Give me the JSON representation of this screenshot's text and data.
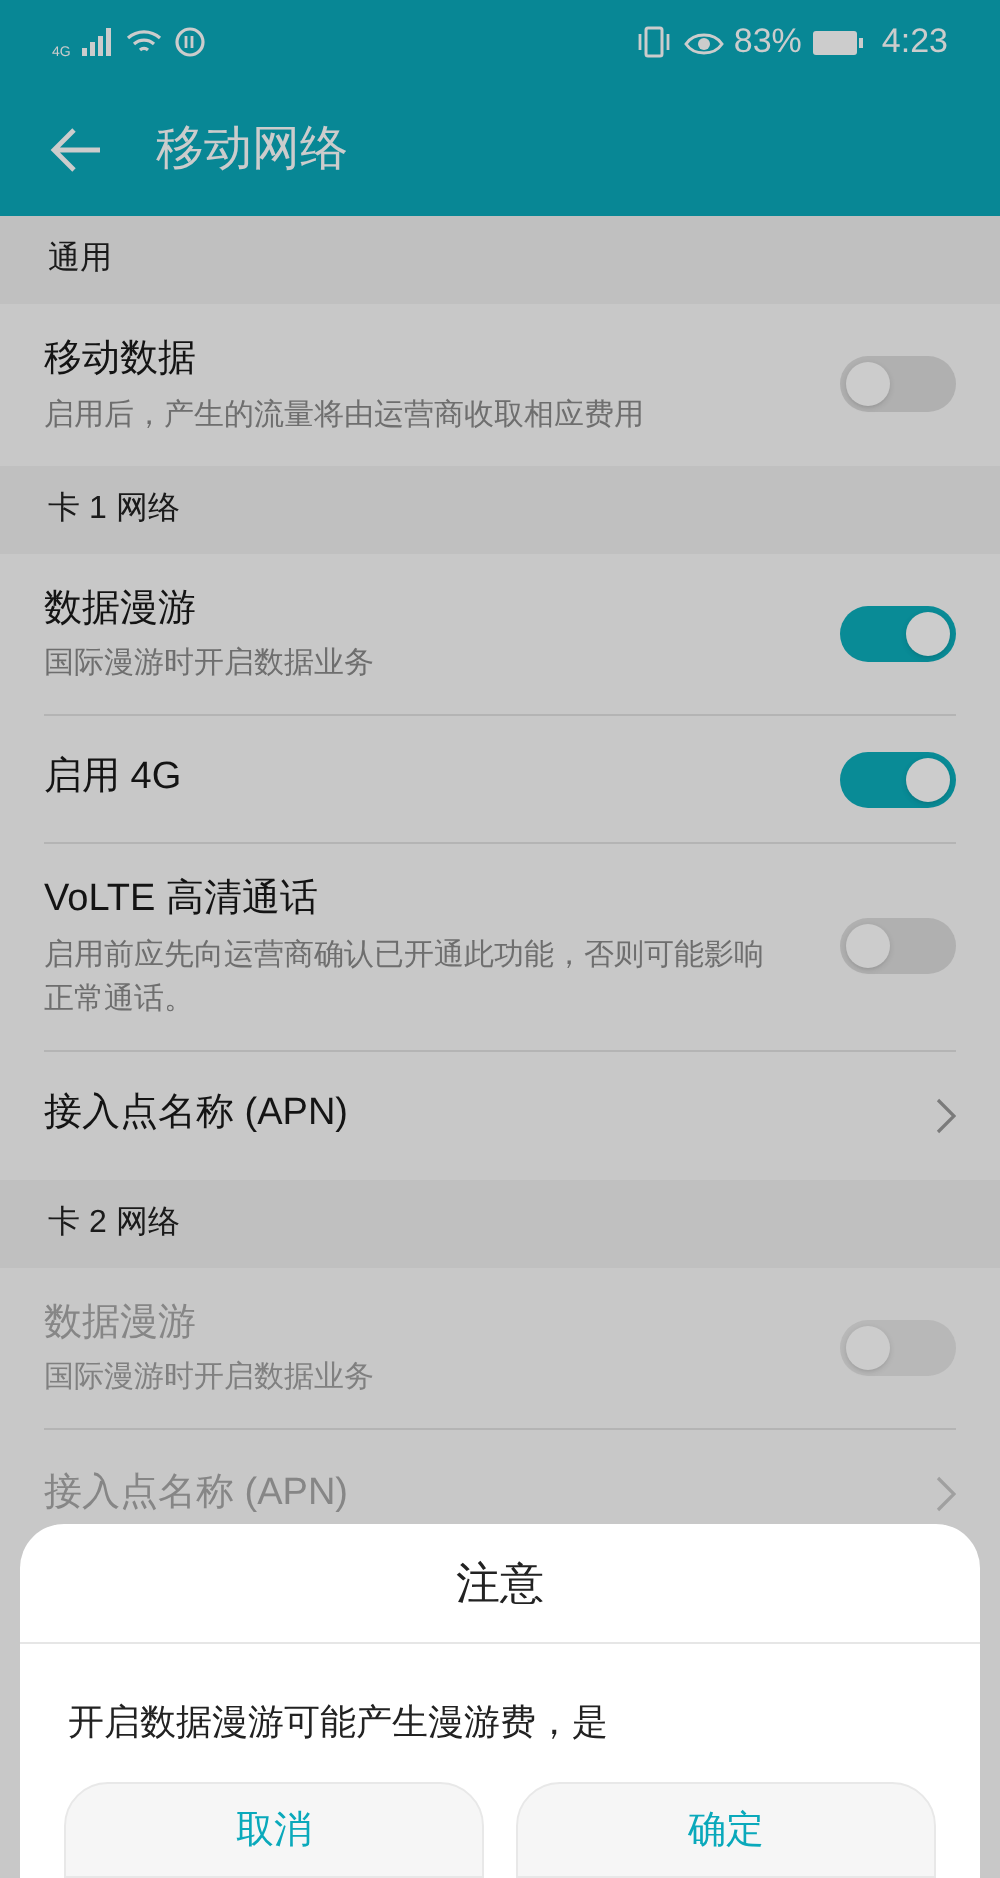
{
  "status_bar": {
    "network": "4G",
    "battery": "83%",
    "time": "4:23"
  },
  "app_bar": {
    "title": "移动网络"
  },
  "sections": [
    {
      "title": "通用",
      "items": [
        {
          "kind": "toggle",
          "title": "移动数据",
          "subtitle": "启用后，产生的流量将由运营商收取相应费用",
          "on": false,
          "disabled": false
        }
      ]
    },
    {
      "title": "卡 1 网络",
      "items": [
        {
          "kind": "toggle",
          "title": "数据漫游",
          "subtitle": "国际漫游时开启数据业务",
          "on": true,
          "disabled": false
        },
        {
          "kind": "toggle",
          "title": "启用 4G",
          "on": true,
          "disabled": false
        },
        {
          "kind": "toggle",
          "title": "VoLTE 高清通话",
          "subtitle": "启用前应先向运营商确认已开通此功能，否则可能影响正常通话。",
          "on": false,
          "disabled": false
        },
        {
          "kind": "link",
          "title": "接入点名称 (APN)",
          "disabled": false
        }
      ]
    },
    {
      "title": "卡 2 网络",
      "items": [
        {
          "kind": "toggle",
          "title": "数据漫游",
          "subtitle": "国际漫游时开启数据业务",
          "on": false,
          "disabled": true
        },
        {
          "kind": "link",
          "title": "接入点名称 (APN)",
          "disabled": true
        }
      ]
    }
  ],
  "dialog": {
    "title": "注意",
    "message": "开启数据漫游可能产生漫游费，是",
    "buttons": [
      "取消",
      "确定"
    ]
  }
}
